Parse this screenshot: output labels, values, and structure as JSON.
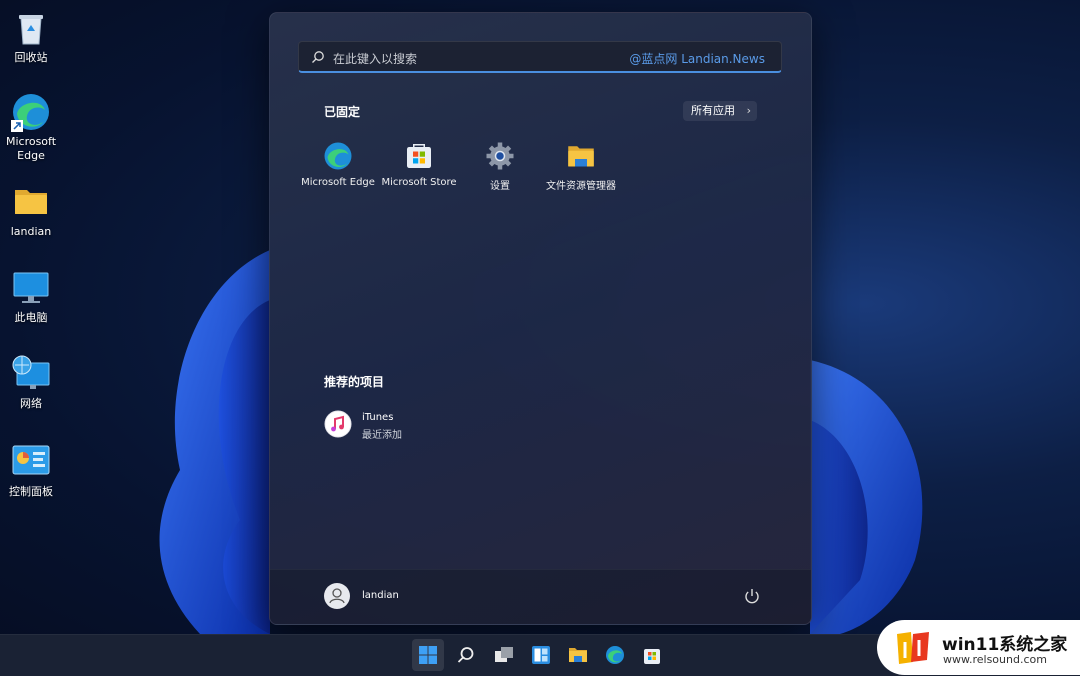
{
  "desktop": {
    "icons": [
      {
        "label": "回收站",
        "icon": "recycle-bin-icon"
      },
      {
        "label": "Microsoft Edge",
        "icon": "edge-icon"
      },
      {
        "label": "landian",
        "icon": "folder-icon"
      },
      {
        "label": "此电脑",
        "icon": "computer-icon"
      },
      {
        "label": "网络",
        "icon": "network-icon"
      },
      {
        "label": "控制面板",
        "icon": "control-panel-icon"
      }
    ]
  },
  "start_menu": {
    "search": {
      "placeholder": "在此键入以搜索",
      "watermark": "@蓝点网 Landian.News"
    },
    "pinned": {
      "title": "已固定",
      "all_apps_label": "所有应用",
      "apps": [
        {
          "label": "Microsoft Edge",
          "icon": "edge-icon"
        },
        {
          "label": "Microsoft Store",
          "icon": "store-icon"
        },
        {
          "label": "设置",
          "icon": "settings-icon"
        },
        {
          "label": "文件资源管理器",
          "icon": "file-explorer-icon"
        }
      ]
    },
    "recommended": {
      "title": "推荐的项目",
      "items": [
        {
          "name": "iTunes",
          "sub": "最近添加",
          "icon": "itunes-icon"
        }
      ]
    },
    "footer": {
      "user_name": "landian"
    }
  },
  "taskbar": {
    "items": [
      "start-icon",
      "search-icon",
      "task-view-icon",
      "widgets-icon",
      "file-explorer-icon",
      "edge-icon",
      "store-icon"
    ]
  },
  "site_badge": {
    "title": "win11系统之家",
    "url": "www.relsound.com"
  },
  "colors": {
    "accent": "#4a8fe0",
    "watermark": "#5a9be8"
  }
}
